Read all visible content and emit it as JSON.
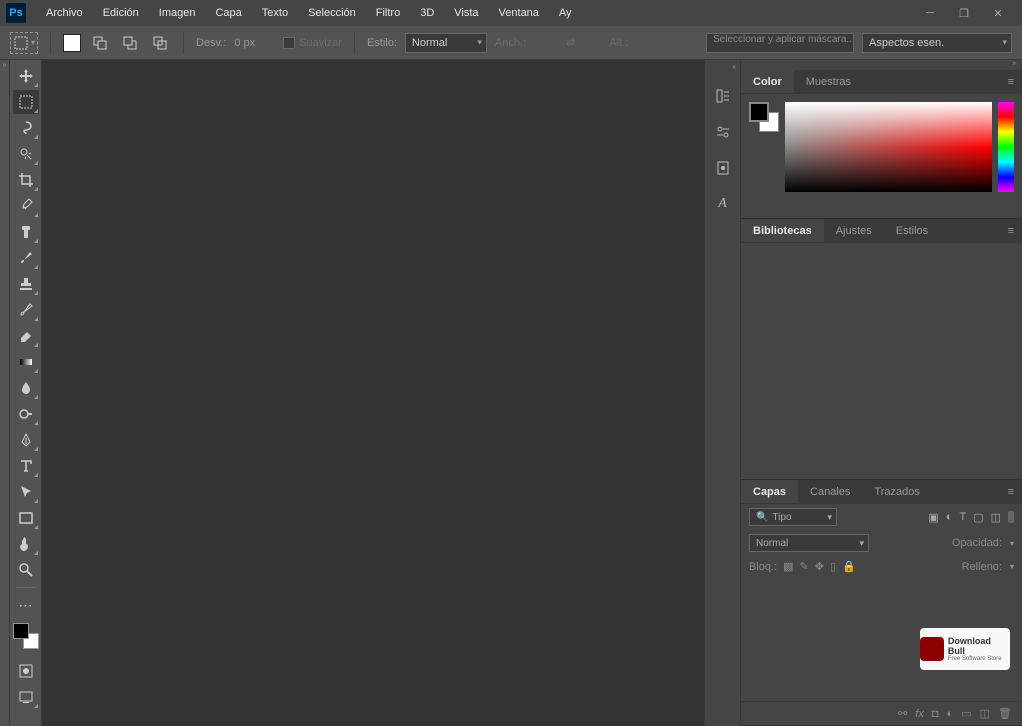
{
  "app": {
    "logo": "Ps"
  },
  "menu": {
    "items": [
      "Archivo",
      "Edición",
      "Imagen",
      "Capa",
      "Texto",
      "Selección",
      "Filtro",
      "3D",
      "Vista",
      "Ventana",
      "Ay"
    ]
  },
  "options": {
    "desv_label": "Desv.:",
    "desv_value": "0 px",
    "suavizar": "Suavizar",
    "estilo_label": "Estilo:",
    "estilo_value": "Normal",
    "anch_label": "Anch.:",
    "alt_label": "Alt.:",
    "mask_button": "Seleccionar y aplicar máscara...",
    "workspace": "Aspectos esen."
  },
  "tools": {
    "items": [
      "move",
      "marquee",
      "lasso",
      "quickselect",
      "crop",
      "eyedropper",
      "healing",
      "brush",
      "stamp",
      "history-brush",
      "eraser",
      "gradient",
      "blur",
      "dodge",
      "pen",
      "type",
      "path-select",
      "rectangle",
      "hand",
      "zoom"
    ],
    "active": "marquee"
  },
  "right_strip": {
    "buttons": [
      "history",
      "properties",
      "device-preview",
      "glyphs"
    ]
  },
  "panels": {
    "color": {
      "tabs": [
        "Color",
        "Muestras"
      ],
      "active": 0,
      "fg": "#000000",
      "bg": "#ffffff"
    },
    "libraries": {
      "tabs": [
        "Bibliotecas",
        "Ajustes",
        "Estilos"
      ],
      "active": 0
    },
    "layers": {
      "tabs": [
        "Capas",
        "Canales",
        "Trazados"
      ],
      "active": 0,
      "filter_label": "Tipo",
      "blend_mode": "Normal",
      "opacity_label": "Opacidad:",
      "lock_label": "Bloq.:",
      "fill_label": "Relleno:"
    }
  },
  "watermark": {
    "brand": "Download Bull",
    "tag": "Free Software Store"
  }
}
